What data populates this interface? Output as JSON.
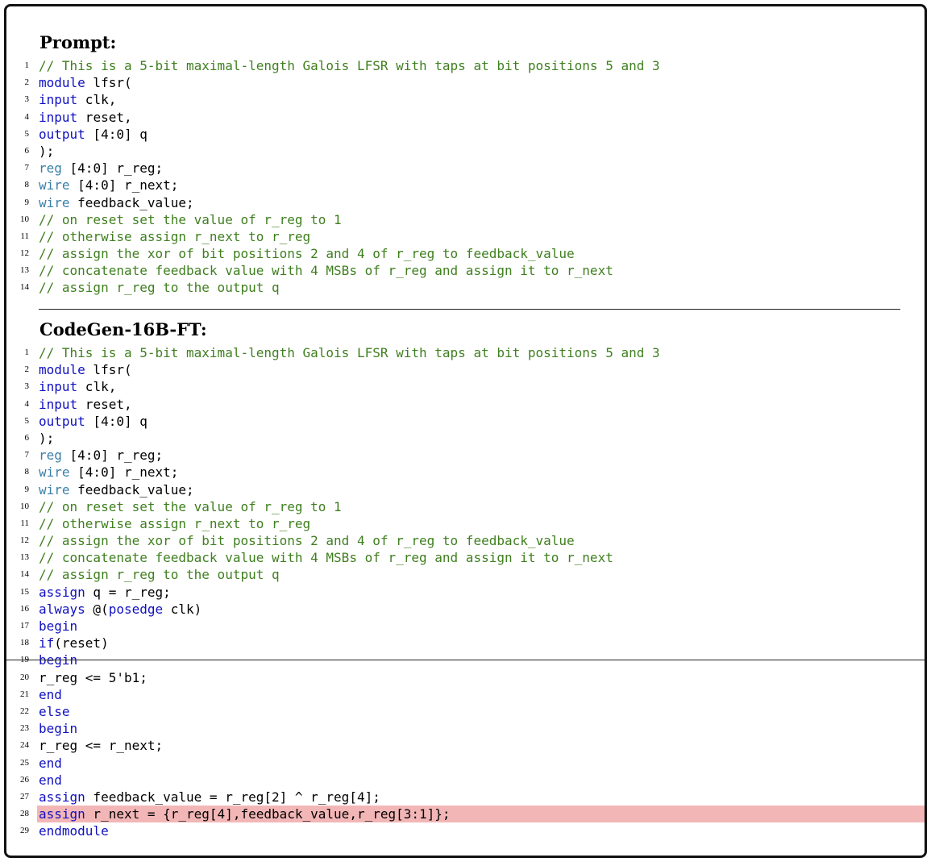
{
  "prompt_title": "Prompt:",
  "completion_title": "CodeGen-16B-FT:",
  "prompt_lines": [
    [
      {
        "t": "// This is a 5-bit maximal-length Galois LFSR with taps at bit positions 5 and 3",
        "c": "cm"
      }
    ],
    [
      {
        "t": "module",
        "c": "kw"
      },
      {
        "t": " lfsr(",
        "c": ""
      }
    ],
    [
      {
        "t": "input",
        "c": "kw"
      },
      {
        "t": " clk,",
        "c": ""
      }
    ],
    [
      {
        "t": "input",
        "c": "kw"
      },
      {
        "t": " reset,",
        "c": ""
      }
    ],
    [
      {
        "t": "output",
        "c": "kw"
      },
      {
        "t": " [4:0] q",
        "c": ""
      }
    ],
    [
      {
        "t": ");",
        "c": ""
      }
    ],
    [
      {
        "t": "reg",
        "c": "ty"
      },
      {
        "t": " [4:0] r_reg;",
        "c": ""
      }
    ],
    [
      {
        "t": "wire",
        "c": "ty"
      },
      {
        "t": " [4:0] r_next;",
        "c": ""
      }
    ],
    [
      {
        "t": "wire",
        "c": "ty"
      },
      {
        "t": " feedback_value;",
        "c": ""
      }
    ],
    [
      {
        "t": "// on reset set the value of r_reg to 1",
        "c": "cm"
      }
    ],
    [
      {
        "t": "// otherwise assign r_next to r_reg",
        "c": "cm"
      }
    ],
    [
      {
        "t": "// assign the xor of bit positions 2 and 4 of r_reg to feedback_value",
        "c": "cm"
      }
    ],
    [
      {
        "t": "// concatenate feedback value with 4 MSBs of r_reg and assign it to r_next",
        "c": "cm"
      }
    ],
    [
      {
        "t": "// assign r_reg to the output q",
        "c": "cm"
      }
    ]
  ],
  "completion_lines": [
    [
      {
        "t": "// This is a 5-bit maximal-length Galois LFSR with taps at bit positions 5 and 3",
        "c": "cm"
      }
    ],
    [
      {
        "t": "module",
        "c": "kw"
      },
      {
        "t": " lfsr(",
        "c": ""
      }
    ],
    [
      {
        "t": "input",
        "c": "kw"
      },
      {
        "t": " clk,",
        "c": ""
      }
    ],
    [
      {
        "t": "input",
        "c": "kw"
      },
      {
        "t": " reset,",
        "c": ""
      }
    ],
    [
      {
        "t": "output",
        "c": "kw"
      },
      {
        "t": " [4:0] q",
        "c": ""
      }
    ],
    [
      {
        "t": ");",
        "c": ""
      }
    ],
    [
      {
        "t": "reg",
        "c": "ty"
      },
      {
        "t": " [4:0] r_reg;",
        "c": ""
      }
    ],
    [
      {
        "t": "wire",
        "c": "ty"
      },
      {
        "t": " [4:0] r_next;",
        "c": ""
      }
    ],
    [
      {
        "t": "wire",
        "c": "ty"
      },
      {
        "t": " feedback_value;",
        "c": ""
      }
    ],
    [
      {
        "t": "// on reset set the value of r_reg to 1",
        "c": "cm"
      }
    ],
    [
      {
        "t": "// otherwise assign r_next to r_reg",
        "c": "cm"
      }
    ],
    [
      {
        "t": "// assign the xor of bit positions 2 and 4 of r_reg to feedback_value",
        "c": "cm"
      }
    ],
    [
      {
        "t": "// concatenate feedback value with 4 MSBs of r_reg and assign it to r_next",
        "c": "cm"
      }
    ],
    [
      {
        "t": "// assign r_reg to the output q",
        "c": "cm"
      }
    ],
    [
      {
        "t": "assign",
        "c": "kw"
      },
      {
        "t": " q = r_reg;",
        "c": ""
      }
    ],
    [
      {
        "t": "always",
        "c": "kw"
      },
      {
        "t": " @(",
        "c": ""
      },
      {
        "t": "posedge",
        "c": "kw"
      },
      {
        "t": " clk)",
        "c": ""
      }
    ],
    [
      {
        "t": "begin",
        "c": "kw"
      }
    ],
    [
      {
        "t": "if",
        "c": "kw"
      },
      {
        "t": "(reset)",
        "c": ""
      }
    ],
    [
      {
        "t": "begin",
        "c": "kw"
      }
    ],
    [
      {
        "t": "r_reg <= 5'b1;",
        "c": ""
      }
    ],
    [
      {
        "t": "end",
        "c": "kw"
      }
    ],
    [
      {
        "t": "else",
        "c": "kw"
      }
    ],
    [
      {
        "t": "begin",
        "c": "kw"
      }
    ],
    [
      {
        "t": "r_reg <= r_next;",
        "c": ""
      }
    ],
    [
      {
        "t": "end",
        "c": "kw"
      }
    ],
    [
      {
        "t": "end",
        "c": "kw"
      }
    ],
    [
      {
        "t": "assign",
        "c": "kw"
      },
      {
        "t": " feedback_value = r_reg[2] ^ r_reg[4];",
        "c": ""
      }
    ],
    [
      {
        "t": "assign",
        "c": "kw"
      },
      {
        "t": " r_next = {r_reg[4],feedback_value,r_reg[3:1]};",
        "c": ""
      }
    ],
    [
      {
        "t": "endmodule",
        "c": "kw"
      }
    ]
  ],
  "highlighted_completion_line": 28,
  "highlight_color": "#f3b6b7",
  "comment_color": "#3f7f1f",
  "keyword_color": "#1010c0",
  "type_color": "#3a7fa8"
}
